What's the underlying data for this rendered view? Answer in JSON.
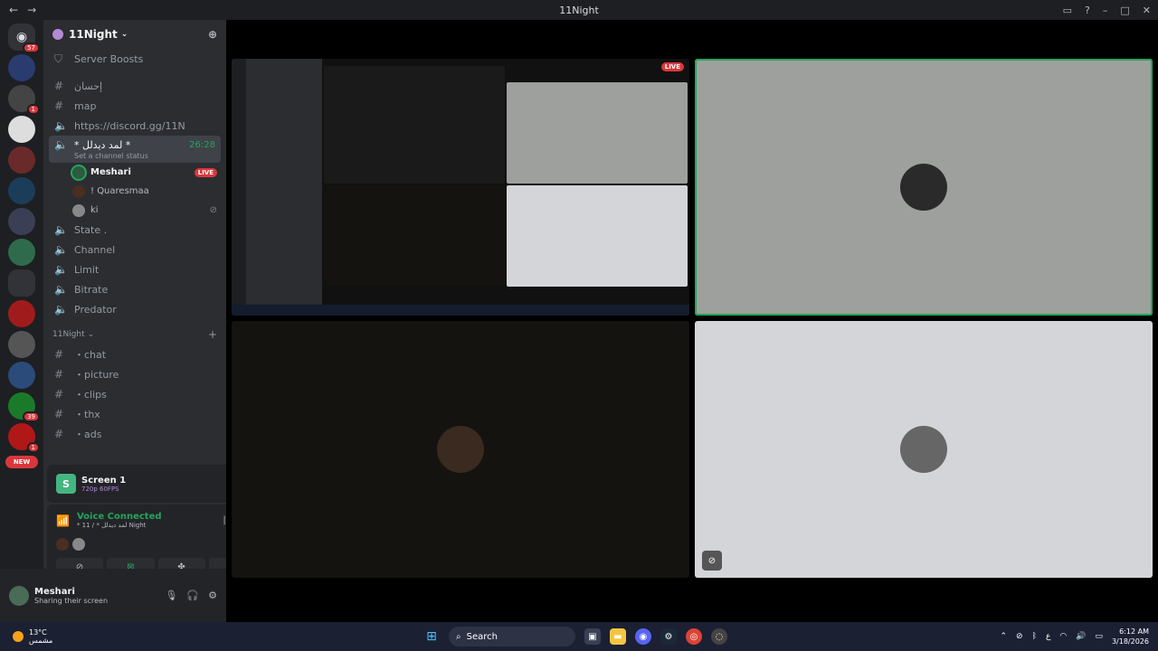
{
  "window": {
    "title": "11Night"
  },
  "guilds": {
    "home_badge": "57",
    "badges": [
      "1",
      "39",
      "1"
    ],
    "new_label": "NEW"
  },
  "server": {
    "name": "11Night"
  },
  "channels": [
    {
      "icon": "shield-icon",
      "label": "Server Boosts"
    },
    {
      "icon": "hash-icon",
      "label": "إحسان"
    },
    {
      "icon": "hash-icon",
      "label": "map"
    },
    {
      "icon": "speaker-icon",
      "label": "https://discord.gg/11N"
    }
  ],
  "active_channel": {
    "label": "* لمد ديدلل *",
    "time": "26:28",
    "status": "Set a channel status"
  },
  "members": [
    {
      "name": "Meshari",
      "live": "LIVE"
    },
    {
      "name": "! Quaresmaa"
    },
    {
      "name": "ki"
    }
  ],
  "voice_channels": [
    "State .",
    "Channel",
    "Limit",
    "Bitrate",
    "Predator"
  ],
  "category": {
    "label": "11Night"
  },
  "text_channels": [
    "・chat",
    "・picture",
    "・clips",
    "・thx",
    "・ads"
  ],
  "screen_share": {
    "title": "Screen 1",
    "quality": "720p 60FPS"
  },
  "voice": {
    "title": "Voice Connected",
    "sub": "* 11 / * لمد ديدلل Night"
  },
  "user": {
    "name": "Meshari",
    "status": "Sharing their screen"
  },
  "stage": {
    "live_label": "LIVE"
  },
  "taskbar": {
    "temp": "13°C",
    "weather": "مشمس",
    "search_placeholder": "Search",
    "lang": "ع",
    "time": "6:12 AM",
    "date": "3/18/2026"
  },
  "colors": {
    "accent_green": "#23a55a",
    "live_red": "#da373c",
    "boost_purple": "#b48ad6"
  }
}
